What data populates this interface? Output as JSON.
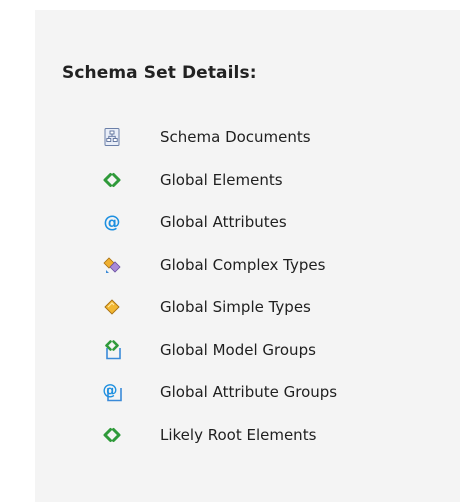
{
  "panel": {
    "title": "Schema Set Details:",
    "items": [
      {
        "label": "Schema Documents",
        "icon": "schema-document-icon"
      },
      {
        "label": "Global Elements",
        "icon": "element-icon"
      },
      {
        "label": "Global Attributes",
        "icon": "attribute-icon"
      },
      {
        "label": "Global Complex Types",
        "icon": "complex-type-icon"
      },
      {
        "label": "Global Simple Types",
        "icon": "simple-type-icon"
      },
      {
        "label": "Global Model Groups",
        "icon": "model-group-icon"
      },
      {
        "label": "Global Attribute Groups",
        "icon": "attribute-group-icon"
      },
      {
        "label": "Likely Root Elements",
        "icon": "element-icon"
      }
    ]
  },
  "colors": {
    "panel_background": "#f4f4f4",
    "element_green": "#2f9a3a",
    "attribute_blue": "#1e90e0",
    "simple_type_gold": "#e0a020"
  }
}
